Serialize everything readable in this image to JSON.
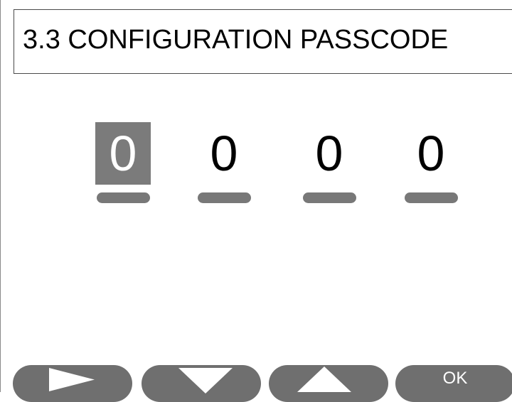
{
  "header": {
    "title": "3.3 CONFIGURATION PASSCODE"
  },
  "passcode": {
    "selected_index": 0,
    "digits": [
      "0",
      "0",
      "0",
      "0"
    ]
  },
  "softkeys": {
    "next_icon": "right-triangle-icon",
    "down_icon": "down-triangle-icon",
    "up_icon": "up-triangle-icon",
    "ok_label": "OK"
  },
  "colors": {
    "selected_digit_background": "#7b7b7b",
    "softkey_background": "#6f6f6f",
    "underline": "#787878"
  }
}
